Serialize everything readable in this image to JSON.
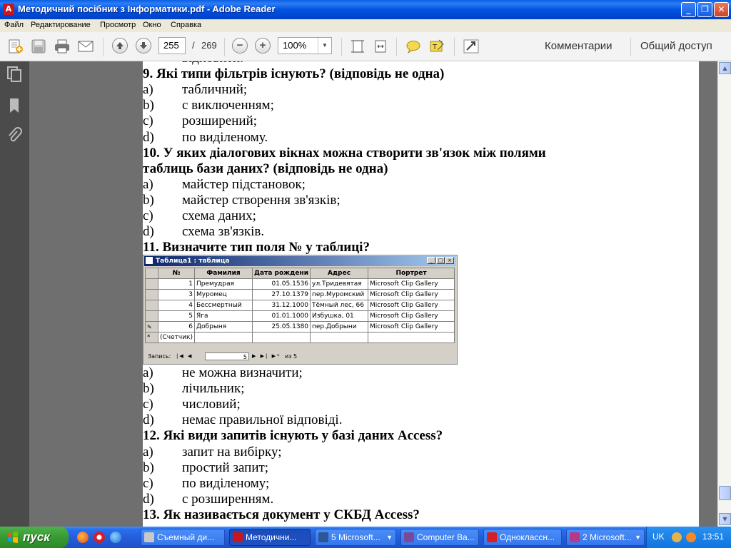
{
  "window": {
    "title": "Методичний посібник з Інформатики.pdf - Adobe Reader",
    "buttons": [
      "_",
      "❐",
      "✕"
    ]
  },
  "menu": [
    "Файл",
    "Редактирование",
    "Просмотр",
    "Окно",
    "Справка"
  ],
  "toolbar": {
    "page_current": "255",
    "page_sep": "/",
    "page_total": "269",
    "zoom": "100%",
    "comments_label": "Комментарии",
    "share_label": "Общий доступ"
  },
  "document": {
    "lines": [
      {
        "kind": "cont",
        "text": "відновити."
      },
      {
        "kind": "q",
        "text": "9. Які типи фільтрів існують? (відповідь не одна)"
      },
      {
        "kind": "opt",
        "letter": "a)",
        "text": "табличний;"
      },
      {
        "kind": "opt",
        "letter": "b)",
        "text": "с виключенням;"
      },
      {
        "kind": "opt",
        "letter": "c)",
        "text": "розширений;"
      },
      {
        "kind": "opt",
        "letter": "d)",
        "text": "по виділеному."
      },
      {
        "kind": "q",
        "text": "10. У яких діалогових вікнах можна створити зв'язок між полями"
      },
      {
        "kind": "q",
        "text": "таблиць бази даних? (відповідь не одна)"
      },
      {
        "kind": "opt",
        "letter": "a)",
        "text": "майстер підстановок;"
      },
      {
        "kind": "opt",
        "letter": "b)",
        "text": "майстер створення зв'язків;"
      },
      {
        "kind": "opt",
        "letter": "c)",
        "text": "схема даних;"
      },
      {
        "kind": "opt",
        "letter": "d)",
        "text": "схема зв'язків."
      },
      {
        "kind": "q",
        "text": "11. Визначите тип поля № у таблиці?"
      }
    ],
    "lines_after": [
      {
        "kind": "opt",
        "letter": "a)",
        "text": "не можна визначити;"
      },
      {
        "kind": "opt",
        "letter": "b)",
        "text": "лічильник;"
      },
      {
        "kind": "opt",
        "letter": "c)",
        "text": "числовий;"
      },
      {
        "kind": "opt",
        "letter": "d)",
        "text": "немає правильної відповіді."
      },
      {
        "kind": "q",
        "text": "12. Які види запитів існують у базі даних Access?"
      },
      {
        "kind": "opt",
        "letter": "a)",
        "text": "запит на вибірку;"
      },
      {
        "kind": "opt",
        "letter": "b)",
        "text": "простий запит;"
      },
      {
        "kind": "opt",
        "letter": "c)",
        "text": "по виділеному;"
      },
      {
        "kind": "opt",
        "letter": "d)",
        "text": "с розширенням."
      },
      {
        "kind": "q",
        "text": "13. Як називається документ у СКБД Access?"
      }
    ]
  },
  "access_table": {
    "title": "Таблица1 : таблица",
    "columns": [
      "№",
      "Фамилия",
      "Дата рождени",
      "Адрес",
      "Портрет"
    ],
    "rows": [
      [
        "1",
        "Премудрая",
        "01.05.1536",
        "ул.Тридевятая",
        "Microsoft Clip Gallery"
      ],
      [
        "3",
        "Муромец",
        "27.10.1379",
        "пер.Муромский",
        "Microsoft Clip Gallery"
      ],
      [
        "4",
        "Бессмертный",
        "31.12.1000",
        "Тёмный лес, 66",
        "Microsoft Clip Gallery"
      ],
      [
        "5",
        "Яга",
        "01.01.1000",
        "Избушка, 01",
        "Microsoft Clip Gallery"
      ],
      [
        "6",
        "Добрыня",
        "25.05.1380",
        "пер.Добрыни",
        "Microsoft Clip Gallery"
      ]
    ],
    "new_row": "(Счетчик)",
    "nav_label": "Запись:",
    "nav_value": "5",
    "nav_total": "из 5"
  },
  "taskbar": {
    "start_label": "пуск",
    "tasks": [
      {
        "label": "Съемный ди...",
        "icon_color": "#c8c8c8"
      },
      {
        "label": "Методични...",
        "icon_color": "#c7161c",
        "active": true
      },
      {
        "label": "5 Microsoft...",
        "icon_color": "#2b5797",
        "chevron": "▼"
      },
      {
        "label": "Computer Ba...",
        "icon_color": "#7a4a9a"
      },
      {
        "label": "Одноклассн...",
        "icon_color": "#d31f26"
      },
      {
        "label": "2 Microsoft...",
        "icon_color": "#b33a8a",
        "chevron": "▼"
      }
    ],
    "lang": "UK",
    "clock": "13:51"
  }
}
